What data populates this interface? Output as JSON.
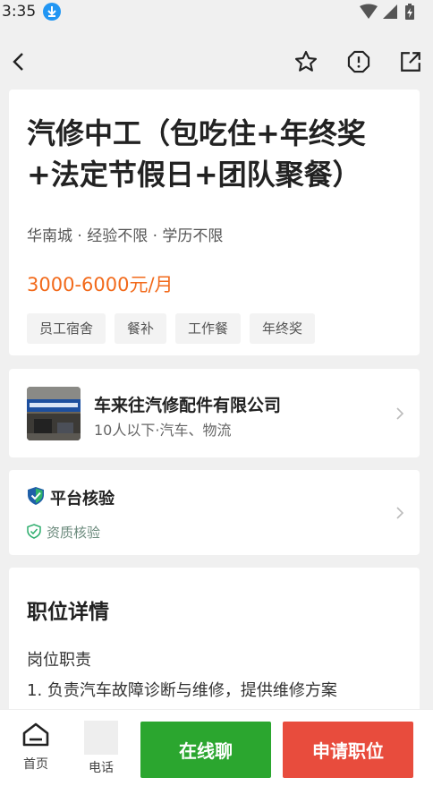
{
  "status": {
    "time": "3:35"
  },
  "job": {
    "title": "汽修中工（包吃住+年终奖+法定节假日+团队聚餐）",
    "meta": "华南城 · 经验不限 ·  学历不限",
    "salary": "3000-6000元/月",
    "tags": [
      "员工宿舍",
      "餐补",
      "工作餐",
      "年终奖"
    ]
  },
  "company": {
    "name": "车来往汽修配件有限公司",
    "info": "10人以下·汽车、物流"
  },
  "verify": {
    "title": "平台核验",
    "sub": "资质核验"
  },
  "details": {
    "title": "职位详情",
    "heading": "岗位职责",
    "line1": "1. 负责汽车故障诊断与维修，提供维修方案"
  },
  "bottom": {
    "home_label": "首页",
    "phone_label": "电话",
    "chat_label": "在线聊",
    "apply_label": "申请职位"
  },
  "colors": {
    "salary": "#f26a1b",
    "chat_button": "#2ba62f",
    "apply_button": "#e84c3d"
  }
}
